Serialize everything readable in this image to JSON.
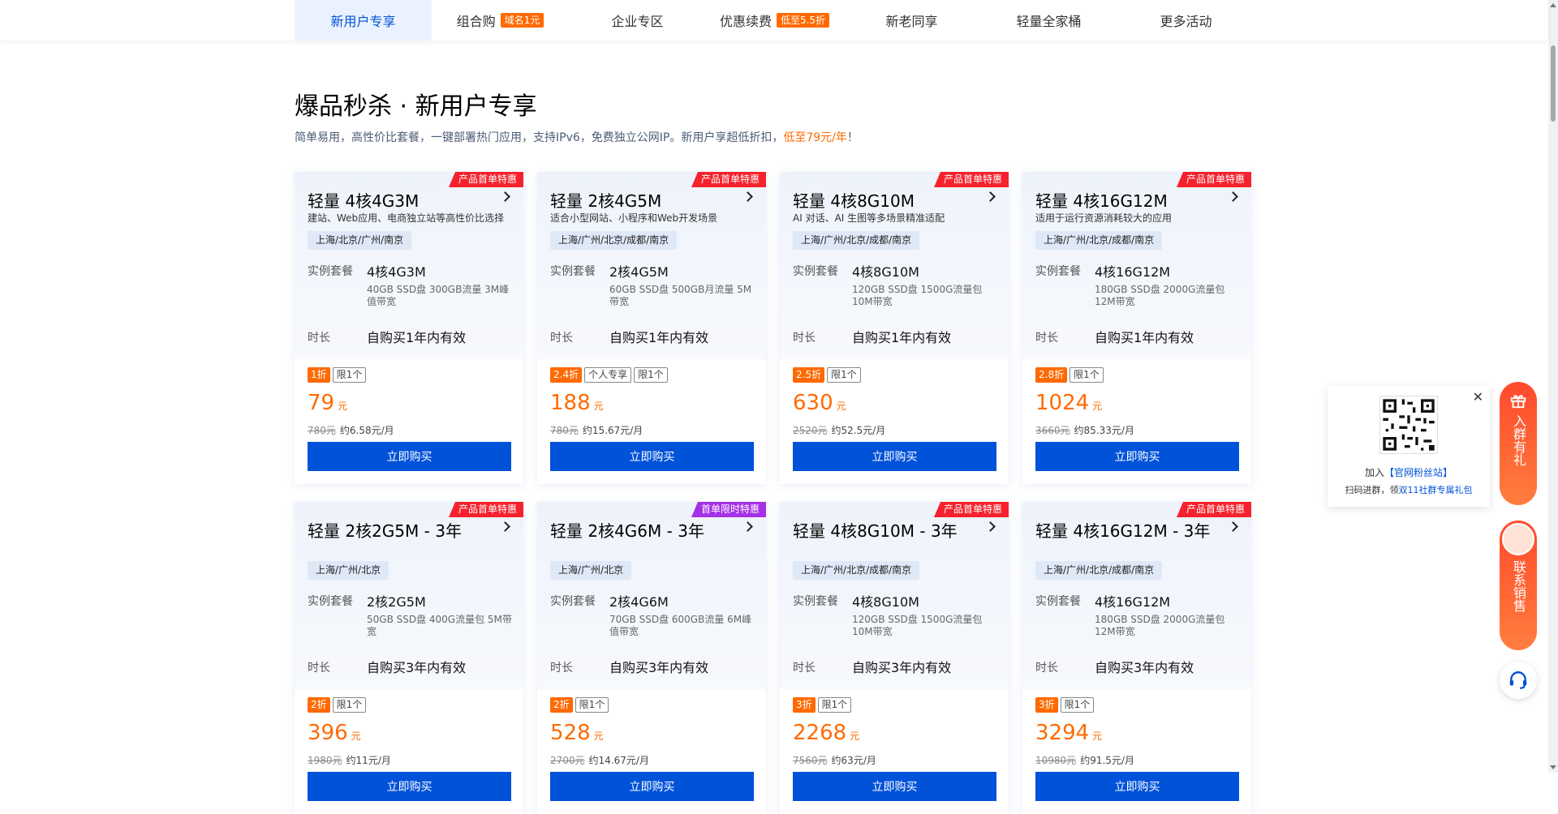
{
  "nav": {
    "tabs": [
      {
        "label": "新用户专享",
        "badge": ""
      },
      {
        "label": "组合购",
        "badge": "域名1元"
      },
      {
        "label": "企业专区",
        "badge": ""
      },
      {
        "label": "优惠续费",
        "badge": "低至5.5折"
      },
      {
        "label": "新老同享",
        "badge": ""
      },
      {
        "label": "轻量全家桶",
        "badge": ""
      },
      {
        "label": "更多活动",
        "badge": ""
      }
    ]
  },
  "section": {
    "title": "爆品秒杀 · 新用户专享",
    "desc_prefix": "简单易用，高性价比套餐，一键部署热门应用，支持IPv6，免费独立公网IP。新用户享超低折扣，",
    "desc_highlight": "低至79元/年",
    "desc_suffix": "！"
  },
  "labels": {
    "package": "实例套餐",
    "duration": "时长",
    "currency": "元",
    "buy": "立即购买"
  },
  "cards": [
    {
      "ribbon": "产品首单特惠",
      "title": "轻量 4核4G3M",
      "subtitle": "建站、Web应用、电商独立站等高性价比选择",
      "region": "上海/北京/广州/南京",
      "pkg": "4核4G3M",
      "pkg_detail": "40GB SSD盘 300GB流量 3M峰值带宽",
      "duration": "自购买1年内有效",
      "discount": "1折",
      "tag2": "限1个",
      "tag3": "",
      "price": "79",
      "original": "780元",
      "monthly": "约6.58元/月"
    },
    {
      "ribbon": "产品首单特惠",
      "title": "轻量 2核4G5M",
      "subtitle": "适合小型网站、小程序和Web开发场景",
      "region": "上海/广州/北京/成都/南京",
      "pkg": "2核4G5M",
      "pkg_detail": "60GB SSD盘 500GB月流量 5M带宽",
      "duration": "自购买1年内有效",
      "discount": "2.4折",
      "tag2": "个人专享",
      "tag3": "限1个",
      "price": "188",
      "original": "780元",
      "monthly": "约15.67元/月"
    },
    {
      "ribbon": "产品首单特惠",
      "title": "轻量 4核8G10M",
      "subtitle": "AI 对话、AI 生图等多场景精准适配",
      "region": "上海/广州/北京/成都/南京",
      "pkg": "4核8G10M",
      "pkg_detail": "120GB SSD盘 1500G流量包 10M带宽",
      "duration": "自购买1年内有效",
      "discount": "2.5折",
      "tag2": "限1个",
      "tag3": "",
      "price": "630",
      "original": "2520元",
      "monthly": "约52.5元/月"
    },
    {
      "ribbon": "产品首单特惠",
      "title": "轻量 4核16G12M",
      "subtitle": "适用于运行资源消耗较大的应用",
      "region": "上海/广州/北京/成都/南京",
      "pkg": "4核16G12M",
      "pkg_detail": "180GB SSD盘 2000G流量包 12M带宽",
      "duration": "自购买1年内有效",
      "discount": "2.8折",
      "tag2": "限1个",
      "tag3": "",
      "price": "1024",
      "original": "3660元",
      "monthly": "约85.33元/月"
    },
    {
      "ribbon": "产品首单特惠",
      "title": "轻量 2核2G5M - 3年",
      "subtitle": "",
      "region": "上海/广州/北京",
      "pkg": "2核2G5M",
      "pkg_detail": "50GB SSD盘 400G流量包 5M带宽",
      "duration": "自购买3年内有效",
      "discount": "2折",
      "tag2": "限1个",
      "tag3": "",
      "price": "396",
      "original": "1980元",
      "monthly": "约11元/月"
    },
    {
      "ribbon": "首单限时特惠",
      "title": "轻量 2核4G6M - 3年",
      "subtitle": "",
      "region": "上海/广州/北京",
      "pkg": "2核4G6M",
      "pkg_detail": "70GB SSD盘 600GB流量 6M峰值带宽",
      "duration": "自购买3年内有效",
      "discount": "2折",
      "tag2": "限1个",
      "tag3": "",
      "price": "528",
      "original": "2700元",
      "monthly": "约14.67元/月"
    },
    {
      "ribbon": "产品首单特惠",
      "title": "轻量 4核8G10M - 3年",
      "subtitle": "",
      "region": "上海/广州/北京/成都/南京",
      "pkg": "4核8G10M",
      "pkg_detail": "120GB SSD盘 1500G流量包 10M带宽",
      "duration": "自购买3年内有效",
      "discount": "3折",
      "tag2": "限1个",
      "tag3": "",
      "price": "2268",
      "original": "7560元",
      "monthly": "约63元/月"
    },
    {
      "ribbon": "产品首单特惠",
      "title": "轻量 4核16G12M - 3年",
      "subtitle": "",
      "region": "上海/广州/北京/成都/南京",
      "pkg": "4核16G12M",
      "pkg_detail": "180GB SSD盘 2000G流量包 12M带宽",
      "duration": "自购买3年内有效",
      "discount": "3折",
      "tag2": "限1个",
      "tag3": "",
      "price": "3294",
      "original": "10980元",
      "monthly": "约91.5元/月"
    }
  ],
  "qr_popup": {
    "line1_prefix": "加入",
    "line1_link": "【官网粉丝站】",
    "line2_prefix": "扫码进群，领",
    "line2_link": "双11社群专属礼包",
    "close": "✕"
  },
  "side": {
    "join_label": "入群有礼",
    "sales_label": "联系销售",
    "support_icon": "headset-icon"
  },
  "colors": {
    "accent_blue": "#0052d9",
    "price_orange": "#ff6a00",
    "ribbon_red": "#f5222d",
    "ribbon_purple": "#a531e6"
  }
}
